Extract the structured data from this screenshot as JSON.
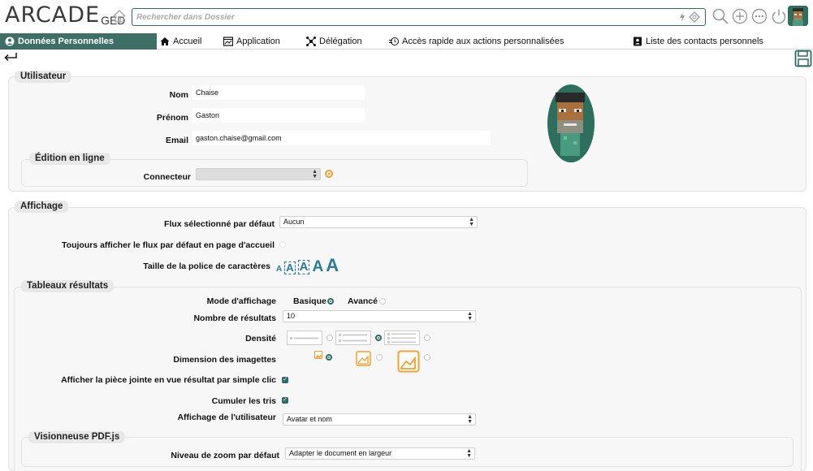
{
  "app": {
    "logo_text": "ARCADE",
    "logo_suffix": "GED"
  },
  "search": {
    "placeholder": "Rechercher dans Dossier"
  },
  "icons": {
    "home": "home-icon",
    "search": "magnifier-icon",
    "add": "plus-circle-icon",
    "more": "ellipsis-circle-icon",
    "power": "power-icon",
    "back": "back-arrow-icon",
    "save": "floppy-icon"
  },
  "colors": {
    "accent": "#3d6f67",
    "brand": "#2d6b60",
    "icon": "#999999",
    "warning": "#f0a030"
  },
  "nav": {
    "items": [
      {
        "label": "Données Personnelles"
      },
      {
        "label": "Accueil"
      },
      {
        "label": "Application"
      },
      {
        "label": "Délégation"
      },
      {
        "label": "Accès rapide aux actions personnalisées"
      },
      {
        "label": "Liste des contacts personnels"
      }
    ]
  },
  "utilisateur": {
    "title": "Utilisateur",
    "nom_label": "Nom",
    "nom_value": "Chaise",
    "prenom_label": "Prénom",
    "prenom_value": "Gaston",
    "email_label": "Email",
    "email_value": "gaston.chaise@gmail.com"
  },
  "edition": {
    "title": "Édition en ligne",
    "connecteur_label": "Connecteur",
    "connecteur_value": ""
  },
  "affichage": {
    "title": "Affichage",
    "flux_label": "Flux sélectionné par défaut",
    "flux_value": "Aucun",
    "toujours_label": "Toujours afficher le flux par défaut en page d'accueil",
    "taille_label": "Taille de la police de caractères",
    "font_sizes": [
      "A",
      "A",
      "A",
      "A",
      "A"
    ]
  },
  "tableaux": {
    "title": "Tableaux résultats",
    "mode_label": "Mode d'affichage",
    "mode_basique": "Basique",
    "mode_avance": "Avancé",
    "nombre_label": "Nombre de résultats",
    "nombre_value": "10",
    "densite_label": "Densité",
    "dimension_label": "Dimension des imagettes",
    "piece_label": "Afficher la pièce jointe en vue résultat par simple clic",
    "cumuler_label": "Cumuler les tris",
    "affichage_user_label": "Affichage de l'utilisateur",
    "affichage_user_value": "Avatar et nom"
  },
  "pdf": {
    "title": "Visionneuse PDF.js",
    "zoom_label": "Niveau de zoom par défaut",
    "zoom_value": "Adapter le document en largeur"
  }
}
